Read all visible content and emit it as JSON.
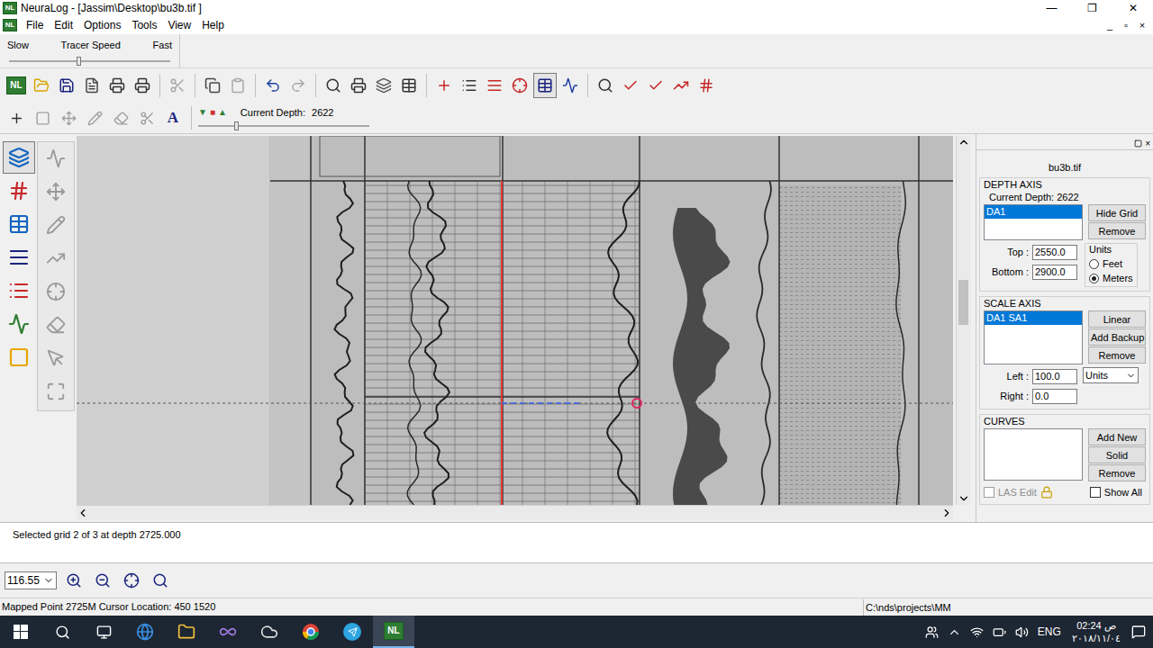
{
  "window": {
    "title": "NeuraLog - [Jassim\\Desktop\\bu3b.tif ]",
    "controls": [
      "—",
      "❐",
      "✕"
    ]
  },
  "logo": "NL",
  "menu": {
    "items": [
      "File",
      "Edit",
      "Options",
      "Tools",
      "View",
      "Help"
    ],
    "mdi_controls": [
      "_",
      "▫",
      "×"
    ]
  },
  "tracer": {
    "slow": "Slow",
    "label": "Tracer Speed",
    "fast": "Fast",
    "level": 0.42
  },
  "toolbar1": {
    "items": [
      {
        "disabled": false,
        "pressed": false
      },
      {
        "disabled": false,
        "pressed": false
      },
      {
        "disabled": false,
        "pressed": false
      },
      {
        "disabled": false,
        "pressed": false
      },
      {
        "disabled": false,
        "pressed": false
      },
      {
        "disabled": false,
        "pressed": false
      },
      {
        "disabled": true,
        "pressed": false
      },
      {
        "disabled": false,
        "pressed": false
      },
      {
        "disabled": true,
        "pressed": false
      },
      {
        "disabled": false,
        "pressed": false
      },
      {
        "disabled": true,
        "pressed": false
      },
      {
        "disabled": false,
        "pressed": false
      },
      {
        "disabled": false,
        "pressed": false
      },
      {
        "disabled": false,
        "pressed": false
      },
      {
        "disabled": false,
        "pressed": false
      },
      {
        "disabled": false,
        "pressed": false
      },
      {
        "disabled": false,
        "pressed": false
      },
      {
        "disabled": false,
        "pressed": false
      },
      {
        "disabled": false,
        "pressed": false
      },
      {
        "disabled": false,
        "pressed": true
      },
      {
        "disabled": false,
        "pressed": false
      },
      {
        "disabled": false,
        "pressed": false
      },
      {
        "disabled": false,
        "pressed": false
      },
      {
        "disabled": false,
        "pressed": false
      },
      {
        "disabled": false,
        "pressed": false
      },
      {
        "disabled": false,
        "pressed": false
      }
    ]
  },
  "toolbar2": {
    "items": [
      {
        "disabled": false
      },
      {
        "disabled": true
      },
      {
        "disabled": true
      },
      {
        "disabled": true
      },
      {
        "disabled": true
      },
      {
        "disabled": true
      }
    ],
    "text_tool": "A",
    "nav": [
      "▼",
      "■",
      "▲"
    ],
    "depth_label": "Current Depth:",
    "depth_value": "2622",
    "depth_level": 0.21
  },
  "left_tools": {
    "col1": [
      {
        "pressed": true
      },
      {
        "pressed": false
      },
      {
        "pressed": false
      },
      {
        "pressed": false
      },
      {
        "pressed": false
      },
      {
        "pressed": false
      },
      {
        "pressed": false
      }
    ],
    "col2": [
      {
        "disabled": true
      },
      {
        "disabled": true
      },
      {
        "disabled": true
      },
      {
        "disabled": true
      },
      {
        "disabled": true
      },
      {
        "disabled": true
      },
      {
        "disabled": true
      },
      {
        "disabled": true
      }
    ]
  },
  "canvas": {
    "v_scroll_level": 0.45
  },
  "panel": {
    "title": "bu3b.tif",
    "depth_axis": {
      "title": "DEPTH AXIS",
      "current_label": "Current Depth:",
      "current_value": "2622",
      "items": [
        {
          "label": "DA1",
          "selected": true
        }
      ],
      "buttons": [
        "Hide Grid",
        "Remove"
      ],
      "top_label": "Top :",
      "top": "2550.0",
      "bottom_label": "Bottom :",
      "bottom": "2900.0",
      "units": {
        "title": "Units",
        "options": [
          {
            "label": "Feet",
            "selected": false
          },
          {
            "label": "Meters",
            "selected": true
          }
        ]
      }
    },
    "scale_axis": {
      "title": "SCALE AXIS",
      "items": [
        {
          "label": "DA1 SA1",
          "selected": true
        }
      ],
      "buttons": [
        "Linear",
        "Add Backup",
        "Remove"
      ],
      "left_label": "Left :",
      "left": "100.0",
      "right_label": "Right :",
      "right": "0.0",
      "units": "Units"
    },
    "curves": {
      "title": "CURVES",
      "items": [],
      "buttons": [
        "Add New",
        "Solid",
        "Remove"
      ],
      "las_edit": {
        "label": "LAS Edit",
        "checked": false,
        "disabled": true
      },
      "show_all": {
        "label": "Show All",
        "checked": false
      }
    }
  },
  "messages": [
    "Selected grid 2 of 3 at depth 2725.000"
  ],
  "zoom": {
    "value": "116.55"
  },
  "status_bar": {
    "left": "Mapped Point 2725M Cursor Location: 450 1520",
    "right": "C:\\nds\\projects\\MM"
  },
  "taskbar": {
    "apps": [
      {
        "selected": false
      },
      {
        "selected": false
      },
      {
        "selected": false
      },
      {
        "selected": false
      },
      {
        "selected": false
      },
      {
        "selected": false
      },
      {
        "selected": false
      },
      {
        "selected": false
      },
      {
        "selected": false
      },
      {
        "selected": true
      }
    ],
    "language": "ENG",
    "time": "02:24 ص",
    "date": "٢٠١٨/١١/٠٤"
  }
}
